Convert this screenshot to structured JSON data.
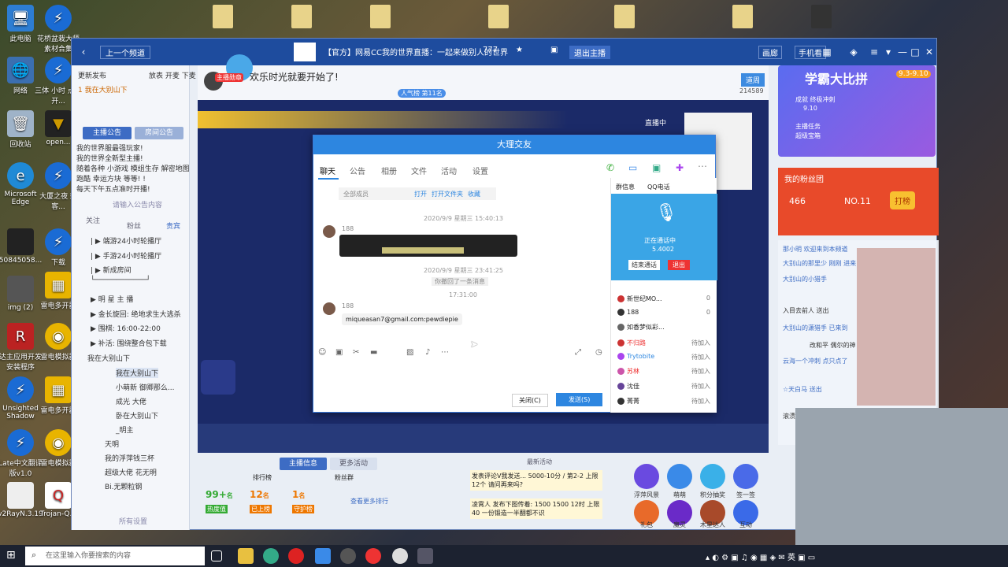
{
  "desktop": {
    "icons": [
      {
        "label": "此电脑"
      },
      {
        "label": "网络"
      },
      {
        "label": "回收站"
      },
      {
        "label": "Microsoft Edge"
      },
      {
        "label": "50845058..."
      },
      {
        "label": "img (2)"
      },
      {
        "label": "达主应用开发 安装程序"
      },
      {
        "label": "Unsighted Shadow"
      },
      {
        "label": "Late中文翻译 版v1.0"
      },
      {
        "label": "v2RayN.3.19"
      }
    ],
    "icons_col2": [
      {
        "label": "花桥盆栽大师 素材合集"
      },
      {
        "label": "三体 小时 点大开..."
      },
      {
        "label": "open..."
      },
      {
        "label": "大厦之夜 刺客..."
      },
      {
        "label": "下载"
      },
      {
        "label": "雷电多开器"
      },
      {
        "label": "雷电模拟器"
      },
      {
        "label": "雷电多开器"
      },
      {
        "label": "雷电模拟器"
      },
      {
        "label": "Trojan-Q..."
      }
    ]
  },
  "window": {
    "back_label": "上一个频道",
    "stream_title": "【官方】网易CC我的世界直播：一起来做别人的世界",
    "viewer_count": "777",
    "follow_label": "退出主播",
    "controls": [
      "画廊",
      "手机看"
    ],
    "header_banner": "欢乐时光就要开始了!",
    "badges": [
      "主播勋章",
      "斗鱼超级",
      "人气榜 第11名"
    ],
    "live_label": "直播中",
    "room_label": "三直播 自己那"
  },
  "left": {
    "top_label": "更新发布",
    "top_label2": "放表 开麦 下麦",
    "line1": "1 我在大别山下",
    "tabs": [
      "主播公告",
      "房间公告"
    ],
    "notice_lines": [
      "我的世界服最强玩家!",
      "我的世界全新型主播!",
      "随着各种 小游戏 模组生存 解密地图",
      "跑酷 幸运方块 等等! !",
      "每天下午五点准时开播!"
    ],
    "notice_more": "请输入公告内容",
    "sub_tabs": [
      "关注",
      "粉丝",
      "贵宾"
    ],
    "channels": [
      "| ▶ 端游24小时轮播厅",
      "| ▶ 手游24小时轮播厅",
      "| ▶ 新成房间",
      "└────────────┘",
      "▶ 明 星 主 播",
      "▶ 金长旋回: 绝地求生大逃杀",
      "▶ 围棋: 16:00-22:00",
      "▶ 补活: 围绕整合包下载"
    ],
    "sub_title": "我在大别山下",
    "members": [
      "我在大别山下",
      "小萌新 御卿那么...",
      "成光 大佬",
      "卧在大别山下",
      "_明主",
      "天明",
      "我的浮萍钱三杯",
      "超级大佬 花无明",
      "Bi.无颗粒钢"
    ],
    "footer_label": "所有设置"
  },
  "qq": {
    "title": "大理交友",
    "tabs": [
      "聊天",
      "公告",
      "相册",
      "文件",
      "活动",
      "设置"
    ],
    "toolbar": [
      "全部成员",
      "打开",
      "打开文件夹",
      "收藏"
    ],
    "timestamp1": "2020/9/9 星期三 15:40:13",
    "sender1": "188",
    "timestamp2": "2020/9/9 星期三 23:41:25",
    "recall_notice": "你撤回了一条消息",
    "time3": "17:31:00",
    "sender2": "188",
    "email_message": "miqueasan7@gmail.com:pewdiepie",
    "close_button": "关闭(C)",
    "send_button": "发送(S)",
    "side_tabs": [
      "群信息",
      "QQ电话"
    ],
    "voice_status": "正在通话中",
    "voice_count": "5.4002",
    "voice_buttons": [
      "结束通话",
      "退出"
    ],
    "members": [
      {
        "name": "新世纪MO...",
        "status": "0"
      },
      {
        "name": "188",
        "status": "0"
      },
      {
        "name": "如香梦似彩...",
        "status": ""
      },
      {
        "name": "不归路",
        "status": "待加入"
      },
      {
        "name": "Trytobite",
        "status": "待加入"
      },
      {
        "name": "苏林",
        "status": "待加入"
      },
      {
        "name": "沈佳",
        "status": "待加入"
      },
      {
        "name": "菁菁",
        "status": "待加入"
      }
    ]
  },
  "right": {
    "rank_button": "道周",
    "rank_count": "214589",
    "event_title": "学霸大比拼",
    "event_dates": "9.3-9.10",
    "event_lines": [
      "成就 终极冲刺",
      "9.10",
      "主播任务",
      "超级宝箱"
    ],
    "fan_title": "我的粉丝团",
    "fan_count": "466",
    "fan_rank": "NO.11",
    "fan_action": "打榜",
    "chat_lines": [
      "那小明 欢迎来到本频道",
      "大别山的那里少 刚刚 进来",
      "大别山的小猎手",
      "入目去前人 送出",
      "大别山的潇猎手 已来到",
      "改和平 偶尔的神",
      "云海一个冲刺 点只点了",
      "☆天白马 送出",
      "滚渍"
    ],
    "gifts": [
      "浮萍风景",
      "萌萌",
      "积分抽奖",
      "签一签",
      "礼包",
      "魔灵",
      "木星达人",
      "互动"
    ]
  },
  "bottom": {
    "tabs": [
      "主播信息",
      "更多活动"
    ],
    "rank_label": "排行榜",
    "fans_label": "粉丝群",
    "stats": [
      {
        "value": "99+",
        "unit": "名",
        "label": "热度值"
      },
      {
        "value": "12",
        "unit": "名",
        "label": "已上榜"
      },
      {
        "value": "1",
        "unit": "名",
        "label": "守护榜"
      }
    ],
    "more_label": "查看更多排行",
    "news_title": "最新活动",
    "news1": "发表评论V我发送... 5000-10分 / 第2-2 上限12个 请问再来吗?",
    "news2": "凌霄人 发布下图传着: 1500 1500 12时 上限40 一份锻造一半翻都不识"
  },
  "taskbar": {
    "search_placeholder": "在这里输入你要搜索的内容"
  }
}
